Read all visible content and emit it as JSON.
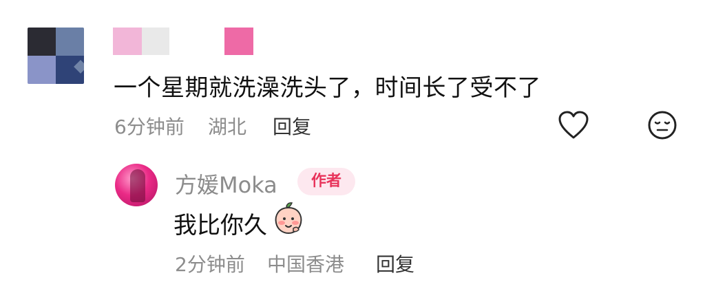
{
  "comment": {
    "text": "一个星期就洗澡洗头了，时间长了受不了",
    "time": "6分钟前",
    "location": "湖北",
    "reply_label": "回复",
    "icons": [
      "heart-icon",
      "face-icon"
    ]
  },
  "reply": {
    "author_name": "方媛Moka",
    "badge": "作者",
    "text": "我比你久",
    "emoji": "peach-blush-emoji",
    "time": "2分钟前",
    "location": "中国香港",
    "reply_label": "回复"
  },
  "colors": {
    "meta": "#8c8c8c",
    "badge_bg": "#fde8ef",
    "badge_text": "#e8335b",
    "brand_pink": "#ea2a86"
  }
}
